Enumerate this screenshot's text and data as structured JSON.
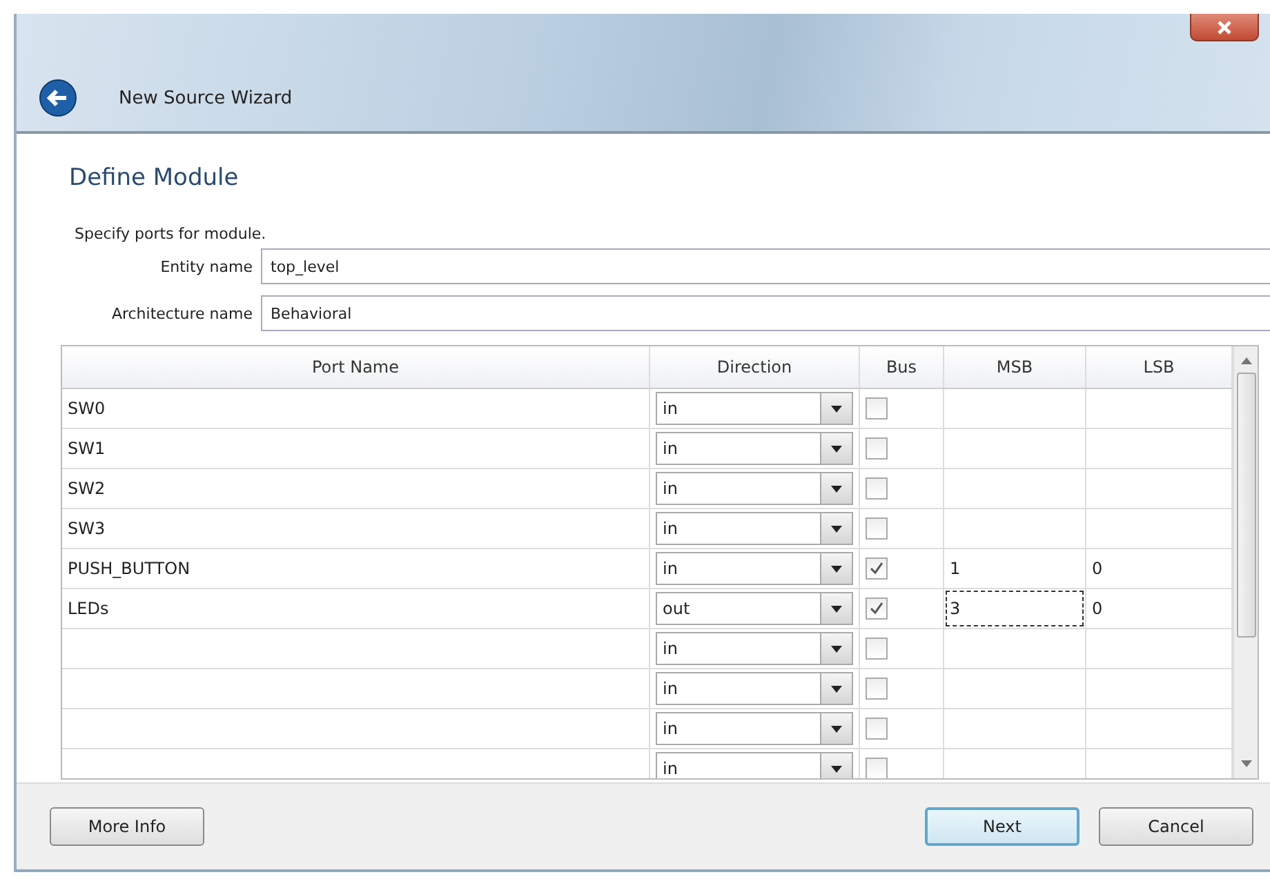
{
  "window": {
    "title": "New Source Wizard"
  },
  "heading": "Define Module",
  "instructions": "Specify ports for module.",
  "fields": [
    {
      "label": "Entity name",
      "value": "top_level"
    },
    {
      "label": "Architecture name",
      "value": "Behavioral"
    }
  ],
  "table": {
    "columns": [
      "Port Name",
      "Direction",
      "Bus",
      "MSB",
      "LSB"
    ],
    "rows": [
      {
        "port_name": "SW0",
        "direction": "in",
        "bus": false,
        "msb_focused": false
      },
      {
        "port_name": "SW1",
        "direction": "in",
        "bus": false,
        "msb_focused": false
      },
      {
        "port_name": "SW2",
        "direction": "in",
        "bus": false,
        "msb_focused": false
      },
      {
        "port_name": "SW3",
        "direction": "in",
        "bus": false,
        "msb_focused": false
      },
      {
        "port_name": "PUSH_BUTTON",
        "direction": "in",
        "bus": true,
        "msb": "1",
        "lsb": "0",
        "msb_focused": false
      },
      {
        "port_name": "LEDs",
        "direction": "out",
        "bus": true,
        "msb": "3",
        "lsb": "0",
        "msb_focused": true
      },
      {
        "direction": "in",
        "bus": false,
        "msb_focused": false
      },
      {
        "direction": "in",
        "bus": false,
        "msb_focused": false
      },
      {
        "direction": "in",
        "bus": false,
        "msb_focused": false
      },
      {
        "direction": "in",
        "bus": false,
        "msb_focused": false
      }
    ]
  },
  "buttons": [
    {
      "label": "More Info",
      "default": false
    },
    {
      "label": "Next",
      "default": true
    },
    {
      "label": "Cancel",
      "default": false
    }
  ]
}
